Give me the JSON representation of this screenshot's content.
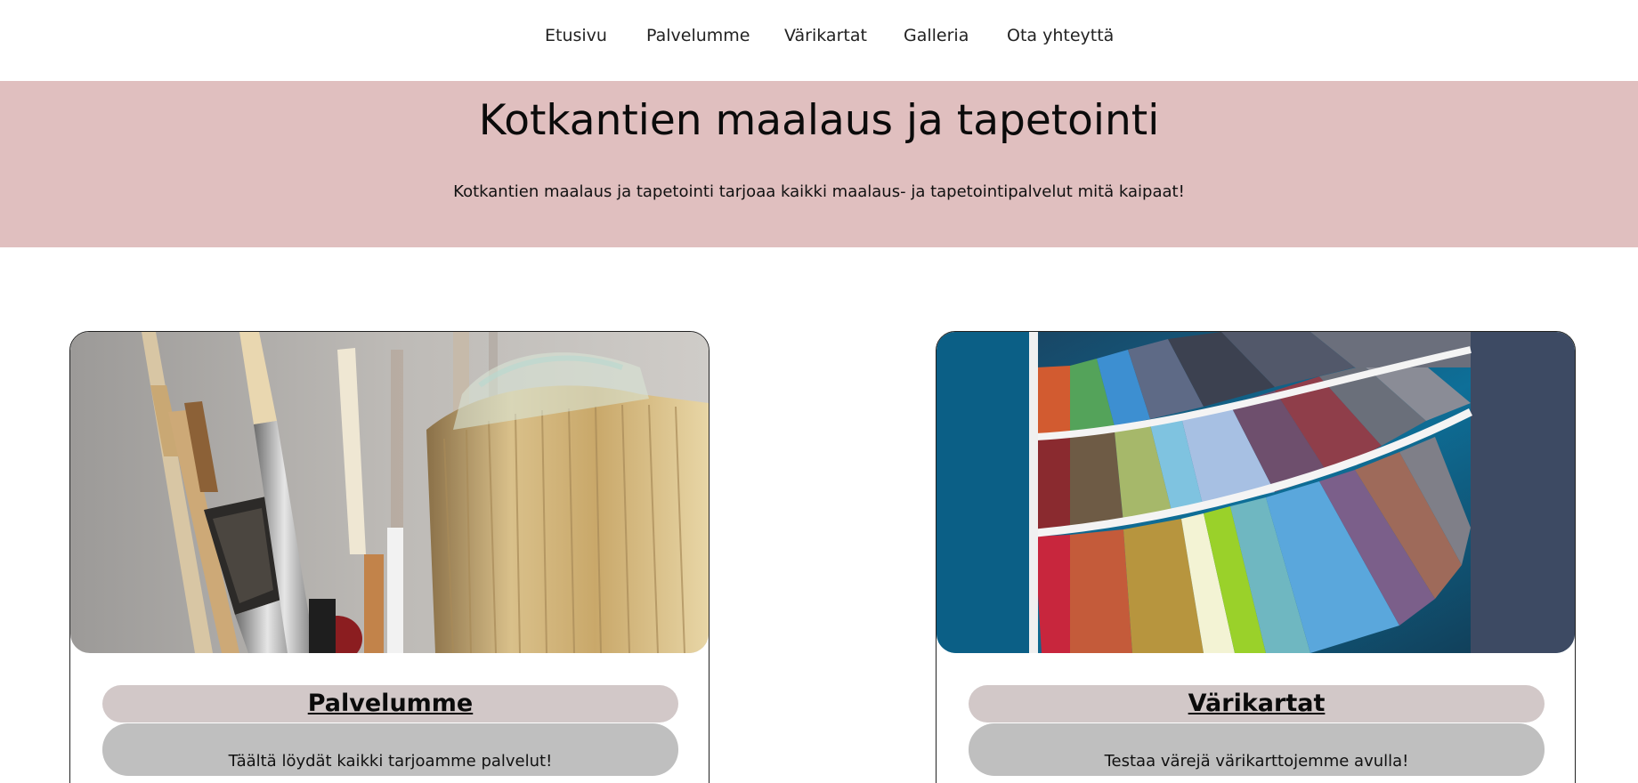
{
  "nav": {
    "items": [
      {
        "label": "Etusivu"
      },
      {
        "label": "Palvelumme"
      },
      {
        "label": "Värikartat"
      },
      {
        "label": "Galleria"
      },
      {
        "label": "Ota yhteyttä"
      }
    ]
  },
  "hero": {
    "title": "Kotkantien maalaus ja tapetointi",
    "text": "Kotkantien maalaus ja tapetointi tarjoaa kaikki maalaus- ja tapetointipalvelut mitä kaipaat!",
    "background": "#e0bfbf"
  },
  "cards": [
    {
      "title": "Palvelumme",
      "description": "Täältä löydät kaikki tarjoamme palvelut!",
      "image": "paint-brushes-photo"
    },
    {
      "title": "Värikartat",
      "description": "Testaa värejä värikarttojemme avulla!",
      "image": "color-swatch-fan-photo"
    }
  ],
  "colors": {
    "title_pill": "#d2c8c8",
    "desc_pill": "#bfbfbf"
  }
}
